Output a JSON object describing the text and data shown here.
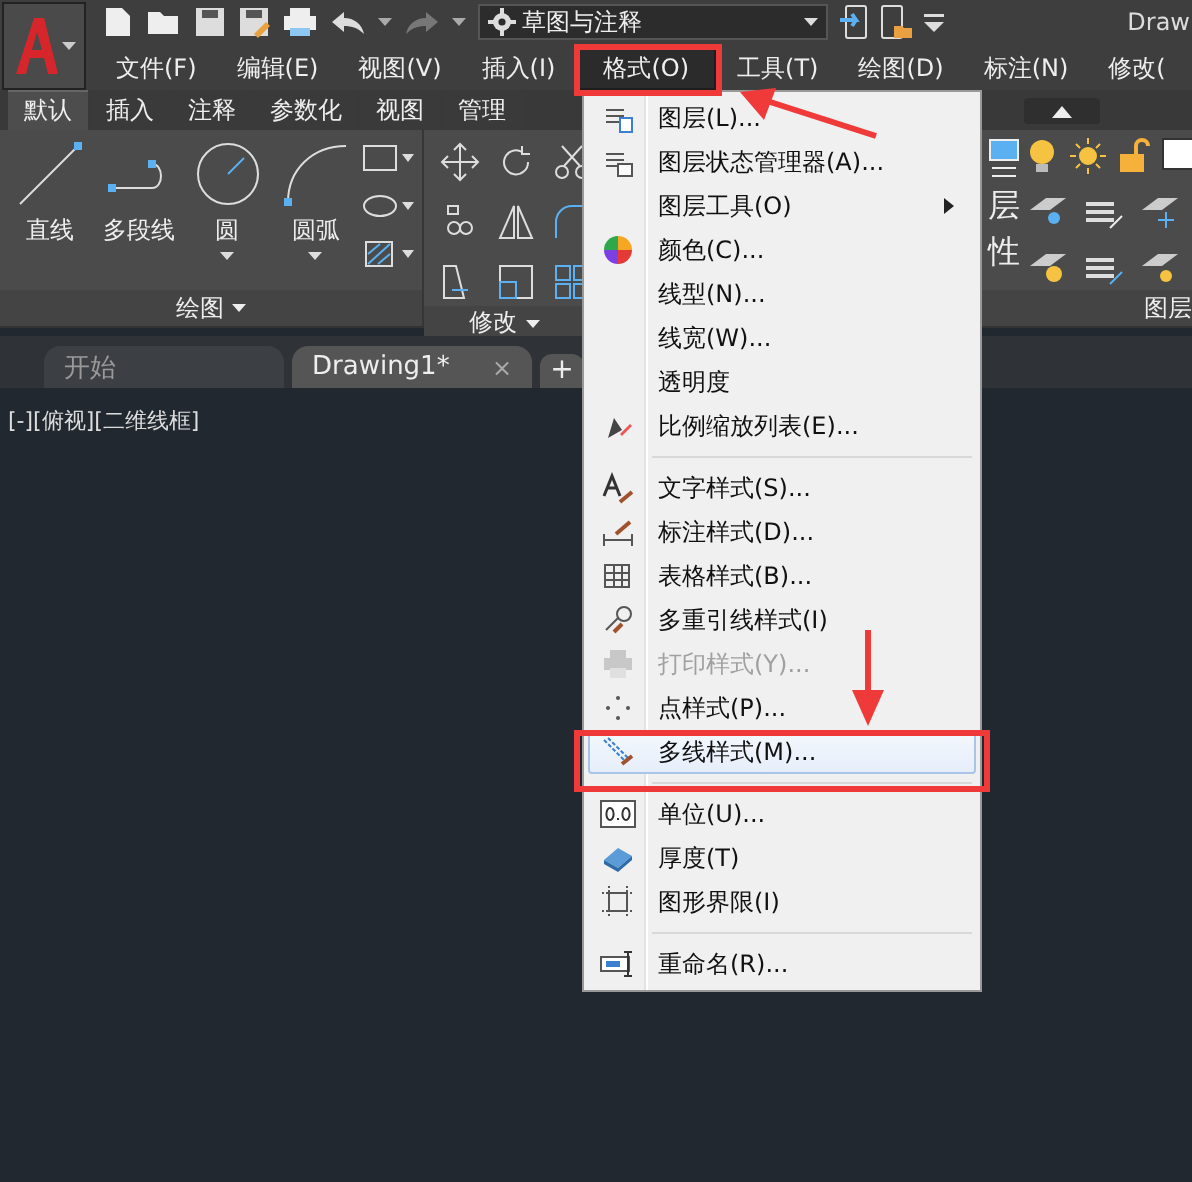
{
  "app": {
    "title": "Draw",
    "workspace": "草图与注释"
  },
  "menubar": [
    {
      "label": "文件(F)",
      "selected": false
    },
    {
      "label": "编辑(E)",
      "selected": false
    },
    {
      "label": "视图(V)",
      "selected": false
    },
    {
      "label": "插入(I)",
      "selected": false
    },
    {
      "label": "格式(O)",
      "selected": true
    },
    {
      "label": "工具(T)",
      "selected": false
    },
    {
      "label": "绘图(D)",
      "selected": false
    },
    {
      "label": "标注(N)",
      "selected": false
    },
    {
      "label": "修改(",
      "selected": false
    }
  ],
  "ribbon": {
    "tabs": [
      {
        "label": "默认",
        "selected": true
      },
      {
        "label": "插入",
        "selected": false
      },
      {
        "label": "注释",
        "selected": false
      },
      {
        "label": "参数化",
        "selected": false
      },
      {
        "label": "视图",
        "selected": false
      },
      {
        "label": "管理",
        "selected": false
      }
    ],
    "draw_panel": {
      "title": "绘图",
      "tools": [
        "直线",
        "多段线",
        "圆",
        "圆弧"
      ]
    },
    "modify_panel": {
      "title": "修改"
    },
    "layer_panel": {
      "title": "图层",
      "button_text": [
        "层",
        "性"
      ]
    }
  },
  "doc_tabs": {
    "tabs": [
      {
        "label": "开始",
        "selected": false
      },
      {
        "label": "Drawing1*",
        "selected": true
      }
    ],
    "close": "×",
    "new_tab": "+"
  },
  "viewport": {
    "label": "[-][俯视][二维线框]"
  },
  "menu": {
    "items": [
      {
        "kind": "item",
        "label": "图层(L)...",
        "disabled": false,
        "selected": false,
        "submenu": false
      },
      {
        "kind": "item",
        "label": "图层状态管理器(A)...",
        "disabled": false,
        "selected": false,
        "submenu": false
      },
      {
        "kind": "item",
        "label": "图层工具(O)",
        "disabled": false,
        "selected": false,
        "submenu": true
      },
      {
        "kind": "item",
        "label": "颜色(C)...",
        "disabled": false,
        "selected": false,
        "submenu": false
      },
      {
        "kind": "item",
        "label": "线型(N)...",
        "disabled": false,
        "selected": false,
        "submenu": false
      },
      {
        "kind": "item",
        "label": "线宽(W)...",
        "disabled": false,
        "selected": false,
        "submenu": false
      },
      {
        "kind": "item",
        "label": "透明度",
        "disabled": false,
        "selected": false,
        "submenu": false
      },
      {
        "kind": "item",
        "label": "比例缩放列表(E)...",
        "disabled": false,
        "selected": false,
        "submenu": false
      },
      {
        "kind": "separator"
      },
      {
        "kind": "item",
        "label": "文字样式(S)...",
        "disabled": false,
        "selected": false,
        "submenu": false
      },
      {
        "kind": "item",
        "label": "标注样式(D)...",
        "disabled": false,
        "selected": false,
        "submenu": false
      },
      {
        "kind": "item",
        "label": "表格样式(B)...",
        "disabled": false,
        "selected": false,
        "submenu": false
      },
      {
        "kind": "item",
        "label": "多重引线样式(I)",
        "disabled": false,
        "selected": false,
        "submenu": false
      },
      {
        "kind": "item",
        "label": "打印样式(Y)...",
        "disabled": true,
        "selected": false,
        "submenu": false
      },
      {
        "kind": "item",
        "label": "点样式(P)...",
        "disabled": false,
        "selected": false,
        "submenu": false
      },
      {
        "kind": "item",
        "label": "多线样式(M)...",
        "disabled": false,
        "selected": true,
        "submenu": false
      },
      {
        "kind": "separator"
      },
      {
        "kind": "item",
        "label": "单位(U)...",
        "disabled": false,
        "selected": false,
        "submenu": false
      },
      {
        "kind": "item",
        "label": "厚度(T)",
        "disabled": false,
        "selected": false,
        "submenu": false
      },
      {
        "kind": "item",
        "label": "图形界限(I)",
        "disabled": false,
        "selected": false,
        "submenu": false
      },
      {
        "kind": "separator"
      },
      {
        "kind": "item",
        "label": "重命名(R)...",
        "disabled": false,
        "selected": false,
        "submenu": false
      }
    ]
  }
}
